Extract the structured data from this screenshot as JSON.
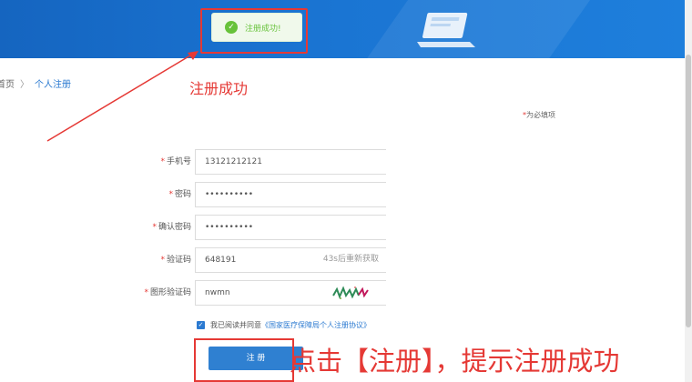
{
  "toast": {
    "icon": "check-circle-icon",
    "message": "注册成功!"
  },
  "breadcrumb": {
    "home": "首页",
    "separator": "〉",
    "current": "个人注册"
  },
  "annotations": {
    "success_note": "注册成功",
    "click_note": "点击【注册】，提示注册成功",
    "color": "#e53935"
  },
  "form": {
    "required_note": "为必填项",
    "fields": [
      {
        "label": "手机号",
        "value": "13121212121"
      },
      {
        "label": "密码",
        "value": "••••••••••"
      },
      {
        "label": "确认密码",
        "value": "••••••••••"
      },
      {
        "label": "验证码",
        "value": "648191",
        "hint": "43s后重新获取"
      },
      {
        "label": "图形验证码",
        "value": "nwmn",
        "captcha_icon": "captcha-image-icon"
      }
    ],
    "agreement": {
      "text": "我已阅读并同意",
      "link": "《国家医疗保障局个人注册协议》"
    },
    "submit_label": "注 册"
  },
  "colors": {
    "banner": "#1a74d2",
    "primary": "#2f80d1",
    "success": "#67c23a"
  }
}
